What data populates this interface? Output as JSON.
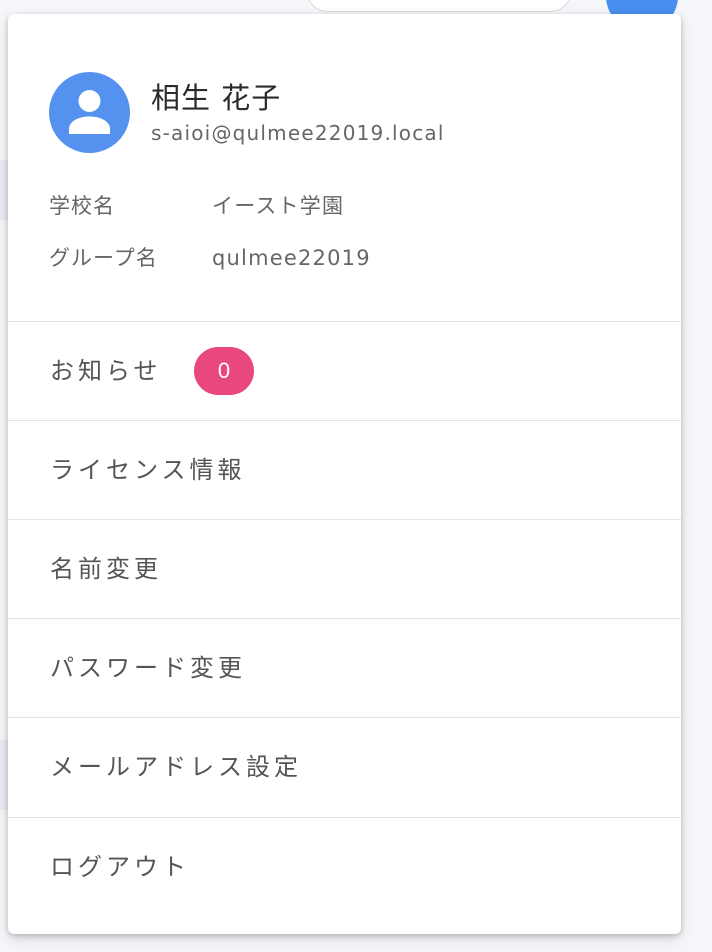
{
  "user": {
    "name": "相生 花子",
    "email": "s-aioi@qulmee22019.local",
    "avatar_icon": "person-icon"
  },
  "info": [
    {
      "label": "学校名",
      "value": "イースト学園"
    },
    {
      "label": "グループ名",
      "value": "qulmee22019"
    }
  ],
  "menu": {
    "notifications": {
      "label": "お知らせ",
      "count": "0"
    },
    "license": {
      "label": "ライセンス情報"
    },
    "change_name": {
      "label": "名前変更"
    },
    "change_password": {
      "label": "パスワード変更"
    },
    "email_settings": {
      "label": "メールアドレス設定"
    },
    "logout": {
      "label": "ログアウト"
    }
  },
  "colors": {
    "avatar": "#5591ee",
    "badge": "#e9487e"
  }
}
